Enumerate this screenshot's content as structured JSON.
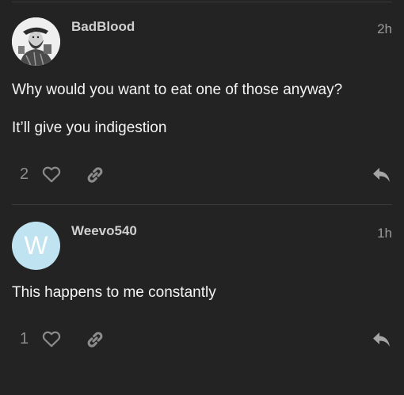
{
  "posts": [
    {
      "username": "BadBlood",
      "time": "2h",
      "avatar_icon": "user-photo-avatar",
      "paragraphs": [
        "Why would you want to eat one of those anyway?",
        "It’ll give you indigestion"
      ],
      "like_count": "2"
    },
    {
      "username": "Weevo540",
      "time": "1h",
      "avatar_letter": "W",
      "avatar_color": "#bfe3f1",
      "paragraphs": [
        "This happens to me constantly"
      ],
      "like_count": "1"
    }
  ],
  "icons": {
    "like": "heart-icon",
    "share": "link-icon",
    "reply": "reply-icon"
  },
  "colors": {
    "background": "#232323",
    "text": "#f5f5f5",
    "muted": "#8c8c8c"
  }
}
